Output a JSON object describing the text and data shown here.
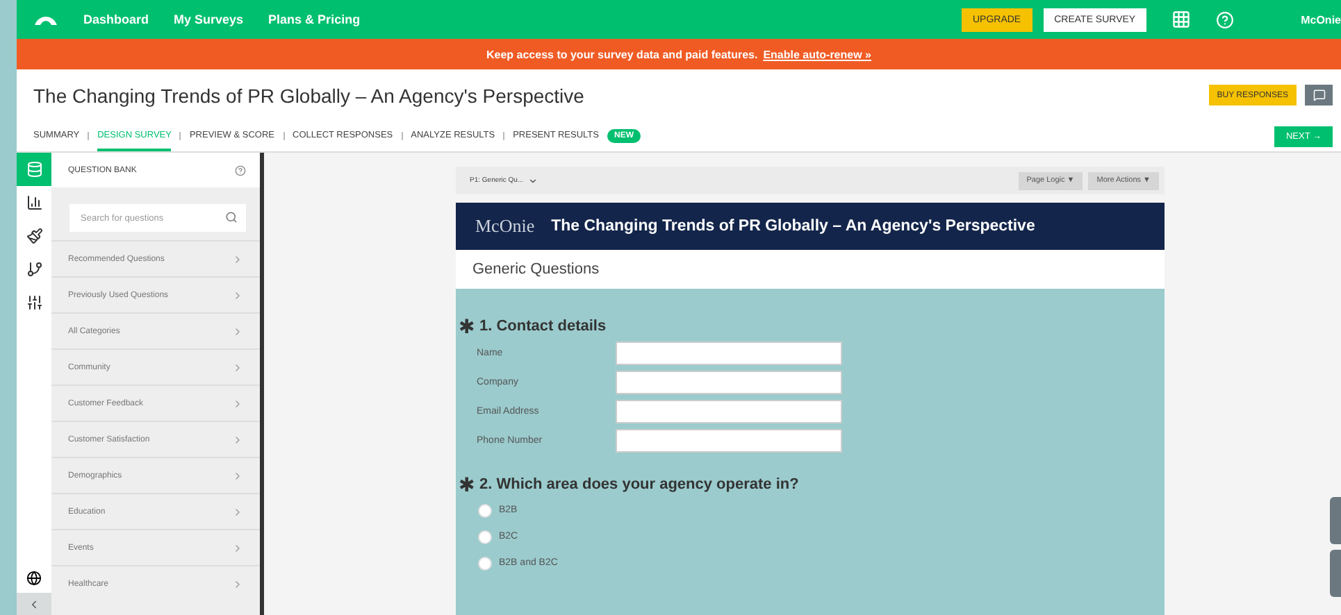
{
  "topnav": {
    "links": [
      "Dashboard",
      "My Surveys",
      "Plans & Pricing"
    ],
    "upgrade": "UPGRADE",
    "create": "CREATE SURVEY",
    "user": "McOnie"
  },
  "banner": {
    "text": "Keep access to your survey data and paid features.",
    "link": "Enable auto-renew »"
  },
  "header": {
    "title": "The Changing Trends of PR Globally – An Agency's Perspective",
    "buy": "BUY RESPONSES"
  },
  "steps": [
    {
      "label": "SUMMARY",
      "selected": false
    },
    {
      "label": "DESIGN SURVEY",
      "selected": true
    },
    {
      "label": "PREVIEW & SCORE",
      "selected": false
    },
    {
      "label": "COLLECT RESPONSES",
      "selected": false
    },
    {
      "label": "ANALYZE RESULTS",
      "selected": false
    },
    {
      "label": "PRESENT RESULTS",
      "selected": false,
      "badge": "NEW"
    }
  ],
  "next": "NEXT →",
  "rail": [
    {
      "kind": "bank",
      "selected": true
    },
    {
      "kind": "chart",
      "selected": false
    },
    {
      "kind": "brush",
      "selected": false
    },
    {
      "kind": "logic",
      "selected": false
    },
    {
      "kind": "sliders",
      "selected": false
    }
  ],
  "question_bank": {
    "title": "QUESTION BANK",
    "placeholder": "Search for questions",
    "items": [
      "Recommended Questions",
      "Previously Used Questions",
      "All Categories",
      "Community",
      "Customer Feedback",
      "Customer Satisfaction",
      "Demographics",
      "Education",
      "Events",
      "Healthcare"
    ]
  },
  "toolbar": {
    "page": "P1: Generic Qu...",
    "buttons": [
      "Page Logic ▼",
      "More Actions ▼"
    ]
  },
  "survey": {
    "required_mark": "✱",
    "logo": "McOnie",
    "title": "The Changing Trends of PR Globally – An Agency's Perspective",
    "page_title": "Generic Questions",
    "questions": [
      {
        "kind": "fields",
        "required": true,
        "title": "1. Contact details",
        "fields": [
          "Name",
          "Company",
          "Email Address",
          "Phone Number"
        ]
      },
      {
        "kind": "radio",
        "required": true,
        "title": "2. Which area does your agency operate in?",
        "options": [
          {
            "label": "B2B",
            "selected": false
          },
          {
            "label": "B2C",
            "selected": false
          },
          {
            "label": "B2B and B2C",
            "selected": false
          }
        ]
      }
    ]
  }
}
